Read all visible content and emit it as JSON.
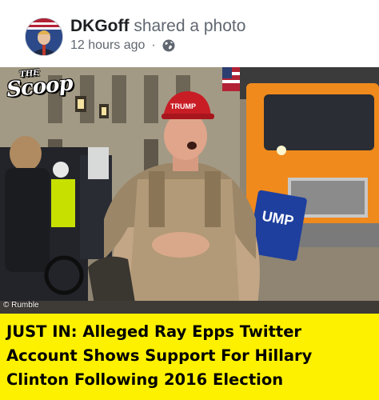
{
  "post": {
    "author": "DKGoff",
    "action_text": " shared a photo",
    "timestamp": "12 hours ago",
    "separator": "·",
    "privacy_icon": "globe-icon"
  },
  "photo": {
    "logo_small": "THE",
    "logo_big": "Scoop",
    "watermark": "© Rumble",
    "hat_text": "TRUMP",
    "sign_text": "UMP"
  },
  "caption": {
    "text": "JUST IN: Alleged Ray Epps Twitter Account Shows Support For Hillary Clinton Following 2016 Election",
    "background": "#fdf100"
  }
}
